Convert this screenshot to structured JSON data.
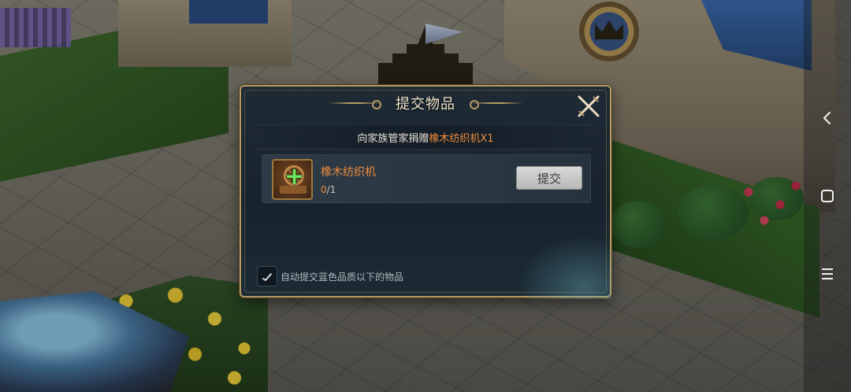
{
  "dialog": {
    "title": "提交物品",
    "subtitle_prefix": "向家族管家捐赠",
    "subtitle_item": "橡木纺织机X1",
    "item": {
      "name": "橡木纺织机",
      "count_have": "0",
      "count_sep_total": "/1",
      "icon": "spinning-wheel-icon"
    },
    "submit_label": "提交",
    "auto_submit_label": "自动提交蓝色品质以下的物品",
    "auto_submit_checked": true
  },
  "navbar": {
    "back_icon": "back-chevron-icon",
    "home_icon": "home-square-icon",
    "menu_icon": "menu-lines-icon"
  },
  "colors": {
    "accent_orange": "#f08a3c",
    "frame_gold": "#b59a63",
    "plus_green": "#6ee35d"
  }
}
